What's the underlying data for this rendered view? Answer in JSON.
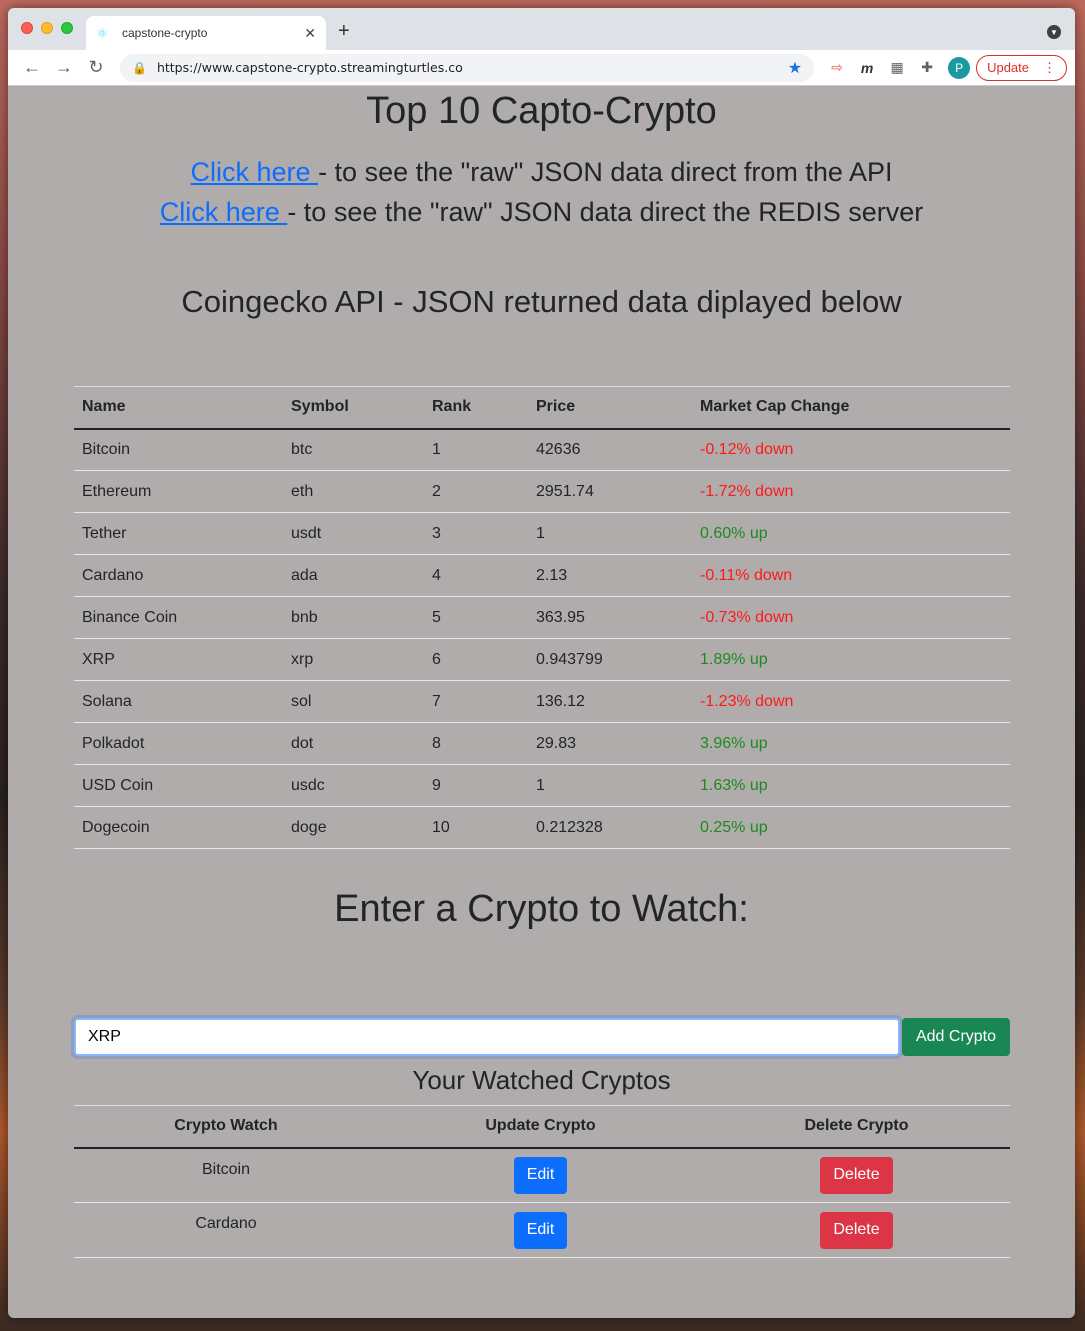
{
  "browser": {
    "tab_title": "capstone-crypto",
    "url": "https://www.capstone-crypto.streamingturtles.co",
    "profile_initial": "P",
    "update_label": "Update"
  },
  "page": {
    "title": "Top 10 Capto-Crypto",
    "links": [
      {
        "link_text": "Click here ",
        "suffix": "- to see the \"raw\" JSON data direct from the API"
      },
      {
        "link_text": "Click here ",
        "suffix": "- to see the \"raw\" JSON data direct the REDIS server"
      }
    ],
    "subtitle": "Coingecko API - JSON returned data diplayed below",
    "table": {
      "headers": [
        "Name",
        "Symbol",
        "Rank",
        "Price",
        "Market Cap Change"
      ],
      "rows": [
        {
          "name": "Bitcoin",
          "symbol": "btc",
          "rank": "1",
          "price": "42636",
          "change": "-0.12% down",
          "dir": "down"
        },
        {
          "name": "Ethereum",
          "symbol": "eth",
          "rank": "2",
          "price": "2951.74",
          "change": "-1.72% down",
          "dir": "down"
        },
        {
          "name": "Tether",
          "symbol": "usdt",
          "rank": "3",
          "price": "1",
          "change": "0.60% up",
          "dir": "up"
        },
        {
          "name": "Cardano",
          "symbol": "ada",
          "rank": "4",
          "price": "2.13",
          "change": "-0.11% down",
          "dir": "down"
        },
        {
          "name": "Binance Coin",
          "symbol": "bnb",
          "rank": "5",
          "price": "363.95",
          "change": "-0.73% down",
          "dir": "down"
        },
        {
          "name": "XRP",
          "symbol": "xrp",
          "rank": "6",
          "price": "0.943799",
          "change": "1.89% up",
          "dir": "up"
        },
        {
          "name": "Solana",
          "symbol": "sol",
          "rank": "7",
          "price": "136.12",
          "change": "-1.23% down",
          "dir": "down"
        },
        {
          "name": "Polkadot",
          "symbol": "dot",
          "rank": "8",
          "price": "29.83",
          "change": "3.96% up",
          "dir": "up"
        },
        {
          "name": "USD Coin",
          "symbol": "usdc",
          "rank": "9",
          "price": "1",
          "change": "1.63% up",
          "dir": "up"
        },
        {
          "name": "Dogecoin",
          "symbol": "doge",
          "rank": "10",
          "price": "0.212328",
          "change": "0.25% up",
          "dir": "up"
        }
      ]
    },
    "enter_heading": "Enter a Crypto to Watch:",
    "crypto_input_value": "XRP",
    "add_button": "Add Crypto",
    "watched_heading": "Your Watched Cryptos",
    "watch_table": {
      "headers": [
        "Crypto Watch",
        "Update Crypto",
        "Delete Crypto"
      ],
      "rows": [
        {
          "name": "Bitcoin",
          "edit": "Edit",
          "delete": "Delete"
        },
        {
          "name": "Cardano",
          "edit": "Edit",
          "delete": "Delete"
        }
      ]
    }
  },
  "colors": {
    "up": "#1f8a1f",
    "down": "#ff1a1a",
    "page_bg": "#afacab",
    "add_button": "#198754",
    "edit_button": "#0d6efd",
    "delete_button": "#dc3545"
  }
}
